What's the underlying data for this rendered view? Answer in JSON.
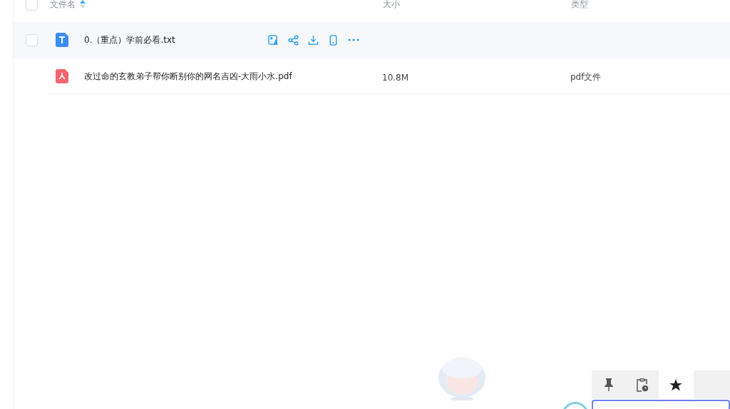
{
  "table": {
    "select_all": {
      "checked": false
    },
    "columns": [
      {
        "label": "文件名",
        "sorted": true
      },
      {
        "label": "大小"
      },
      {
        "label": "类型"
      }
    ],
    "rows": [
      {
        "kind": "txt",
        "name": "0.（重点）学前必看.txt",
        "size": "",
        "type": "",
        "highlighted": true,
        "checked": false
      },
      {
        "kind": "pdf",
        "name": "改过命的玄教弟子帮你断别你的网名吉凶-大雨小水.pdf",
        "size": "10.8M",
        "type": "pdf文件",
        "highlighted": false,
        "checked": false
      }
    ]
  },
  "floating_toolbar": {
    "items": [
      {
        "kind": "pin",
        "selected": false
      },
      {
        "kind": "clipboard",
        "selected": false
      },
      {
        "kind": "star",
        "selected": true
      },
      {
        "kind": "blank"
      }
    ]
  }
}
